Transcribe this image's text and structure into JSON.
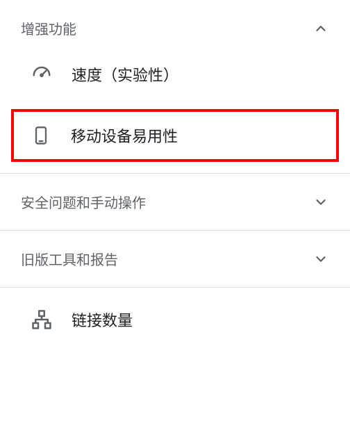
{
  "sections": {
    "enhancements": {
      "title": "增强功能",
      "expanded": true,
      "items": {
        "speed": {
          "label": "速度（实验性）"
        },
        "mobile": {
          "label": "移动设备易用性"
        }
      }
    },
    "security": {
      "title": "安全问题和手动操作",
      "expanded": false
    },
    "legacy": {
      "title": "旧版工具和报告",
      "expanded": false
    },
    "links": {
      "items": {
        "link_count": {
          "label": "链接数量"
        }
      }
    }
  }
}
